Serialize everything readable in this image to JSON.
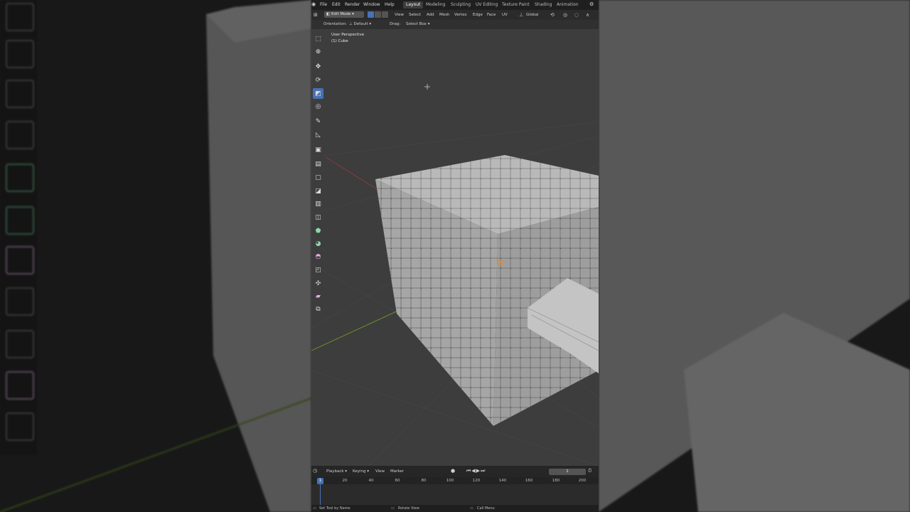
{
  "topbar": {
    "menus": [
      "File",
      "Edit",
      "Render",
      "Window",
      "Help"
    ],
    "workspaces": [
      "Layout",
      "Modeling",
      "Sculpting",
      "UV Editing",
      "Texture Paint",
      "Shading",
      "Animation"
    ],
    "active_workspace": "Layout"
  },
  "header": {
    "mode": "Edit Mode",
    "menus": [
      "View",
      "Select",
      "Add",
      "Mesh",
      "Vertex",
      "Edge",
      "Face",
      "UV"
    ],
    "transform_orientation": "Global"
  },
  "tool_header": {
    "orientation_label": "Orientation:",
    "orientation_value": "Default",
    "drag_label": "Drag:",
    "drag_value": "Select Box"
  },
  "viewport": {
    "perspective_label": "User Perspective",
    "object_label": "(1) Cube"
  },
  "toolbar": {
    "tools": [
      "select-box",
      "cursor",
      "move",
      "rotate",
      "scale",
      "transform",
      "annotate",
      "measure",
      "add-cube",
      "extrude-region",
      "inset-faces",
      "bevel",
      "loop-cut",
      "knife",
      "poly-build",
      "spin",
      "smooth",
      "edge-slide",
      "shrink-fatten",
      "shear",
      "rip-region"
    ],
    "active_tool": "scale"
  },
  "timeline": {
    "menus": [
      "Playback",
      "Keying",
      "View",
      "Marker"
    ],
    "current_frame": "1",
    "ruler_ticks": [
      "20",
      "40",
      "60",
      "80",
      "100",
      "120",
      "140",
      "160",
      "180",
      "200"
    ],
    "playhead_label": "1"
  },
  "statusbar": {
    "items": [
      "Set Tool by Name",
      "Rotate View",
      "Call Menu"
    ]
  },
  "colors": {
    "accent": "#4772b3",
    "viewport_bg": "#3d3d3d",
    "mesh_face": "#b5b5b5",
    "x_axis": "#8a3a3a",
    "y_axis": "#6b8f2a"
  }
}
